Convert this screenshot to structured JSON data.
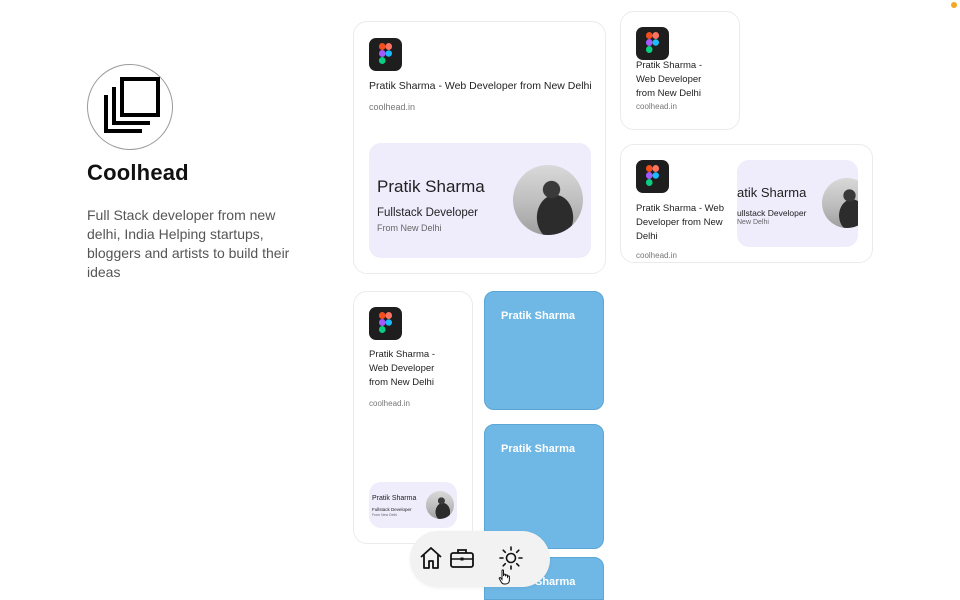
{
  "profile": {
    "name": "Coolhead",
    "bio": "Full Stack developer from new delhi, India Helping startups, bloggers and artists to build their ideas",
    "avatar_icon": "stacked-squares-icon"
  },
  "cards": {
    "large": {
      "title": "Pratik Sharma - Web Developer from New Delhi",
      "domain": "coolhead.in",
      "preview": {
        "name": "Pratik Sharma",
        "role": "Fullstack Developer",
        "location": "From New Delhi"
      }
    },
    "small_top_right": {
      "title_lines": [
        "Pratik Sharma -",
        "Web Developer",
        "from New Delhi"
      ],
      "domain": "coolhead.in"
    },
    "wide_right": {
      "title_lines": [
        "Pratik Sharma - Web",
        "Developer from New",
        "Delhi"
      ],
      "domain": "coolhead.in",
      "preview": {
        "name": "atik Sharma",
        "role": "ullstack Developer",
        "location": "New Delhi"
      }
    },
    "tall_left": {
      "title_lines": [
        "Pratik Sharma -",
        "Web Developer",
        "from New Delhi"
      ],
      "domain": "coolhead.in",
      "preview": {
        "name": "Pratik Sharma",
        "role": "Fullstack Developer",
        "location": "From New Delhi"
      }
    },
    "blue": [
      {
        "label": "Pratik Sharma"
      },
      {
        "label": "Pratik Sharma"
      },
      {
        "label": "Sharma"
      }
    ]
  },
  "dock": {
    "items": [
      "home-icon",
      "briefcase-icon",
      "sun-icon"
    ]
  },
  "colors": {
    "accent_blue": "#6fb7e4",
    "preview_bg": "#efecfc",
    "status_dot": "#f5a623"
  }
}
